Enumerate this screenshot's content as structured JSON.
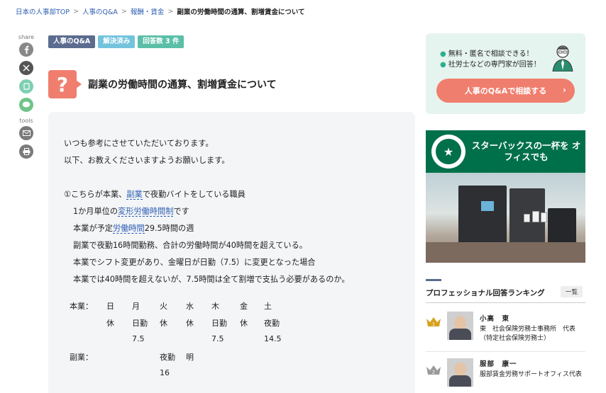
{
  "breadcrumb": {
    "home": "日本の人事部TOP",
    "qa": "人事のQ&A",
    "category": "報酬・賃金",
    "current": "副業の労働時間の通算、割増賃金について",
    "separator": ">"
  },
  "share": {
    "share_label": "share",
    "tools_label": "tools"
  },
  "tags": [
    "人事のQ&A",
    "解決済み",
    "回答数 3 件"
  ],
  "question": {
    "icon": "?",
    "title": "副業の労働時間の通算、割増賃金について",
    "lines": [
      {
        "type": "text",
        "text": "いつも参考にさせていただいております。"
      },
      {
        "type": "text",
        "text": "以下、お教えくださいますようお願いします。"
      },
      {
        "type": "blank"
      },
      {
        "type": "rich",
        "parts": [
          {
            "t": "①こちらが本業、"
          },
          {
            "t": "副業",
            "link": true
          },
          {
            "t": "で夜勤バイトをしている職員"
          }
        ]
      },
      {
        "type": "rich",
        "indent": true,
        "parts": [
          {
            "t": "1か月単位の"
          },
          {
            "t": "変形労働時間制",
            "link": true
          },
          {
            "t": "です"
          }
        ]
      },
      {
        "type": "rich",
        "indent": true,
        "parts": [
          {
            "t": "本業が予定"
          },
          {
            "t": "労働時間",
            "link": true
          },
          {
            "t": "29.5時間の週"
          }
        ]
      },
      {
        "type": "text",
        "indent": true,
        "text": "副業で夜勤16時間勤務、合計の労働時間が40時間を超えている。"
      },
      {
        "type": "text",
        "indent": true,
        "text": "本業でシフト変更があり、金曜日が日勤（7.5）に変更となった場合"
      },
      {
        "type": "text",
        "indent": true,
        "text": "本業では40時間を超えないが、7.5時間は全て割増で支払う必要があるのか。"
      }
    ],
    "schedule": {
      "main_label": "本業：",
      "side_label": "副業：",
      "days": [
        "日",
        "月",
        "火",
        "水",
        "木",
        "金",
        "土"
      ],
      "main_type": [
        "休",
        "日勤",
        "休",
        "休",
        "日勤",
        "休",
        "夜勤"
      ],
      "main_hours": [
        "",
        "7.5",
        "",
        "",
        "7.5",
        "",
        "14.5"
      ],
      "side_type": [
        "",
        "",
        "夜勤",
        "明",
        "",
        "",
        ""
      ],
      "side_hours": [
        "",
        "",
        "16",
        "",
        "",
        "",
        ""
      ]
    }
  },
  "sidebar": {
    "cta": {
      "point1": "無料・匿名で相談できる！",
      "point2": "社労士などの専門家が回答！",
      "button": "人事のQ&Aで相談する",
      "chevron": "›"
    },
    "ad": {
      "text": "スターバックスの一杯を オフィスでも",
      "accent": "#00704a"
    },
    "ranking": {
      "title": "プロフェッショナル回答ランキング",
      "all_button": "一覧",
      "items": [
        {
          "rank": "1",
          "name": "小高　東",
          "org": "東　社会保険労務士事務所　代表（特定社会保険労務士）"
        },
        {
          "rank": "2",
          "name": "服部　康一",
          "org": "服部賃金労務サポートオフィス代表"
        }
      ]
    }
  },
  "colors": {
    "accent_coral": "#f07e6e",
    "link_blue": "#2f5fb3",
    "cta_bg": "#e6f4ef"
  }
}
